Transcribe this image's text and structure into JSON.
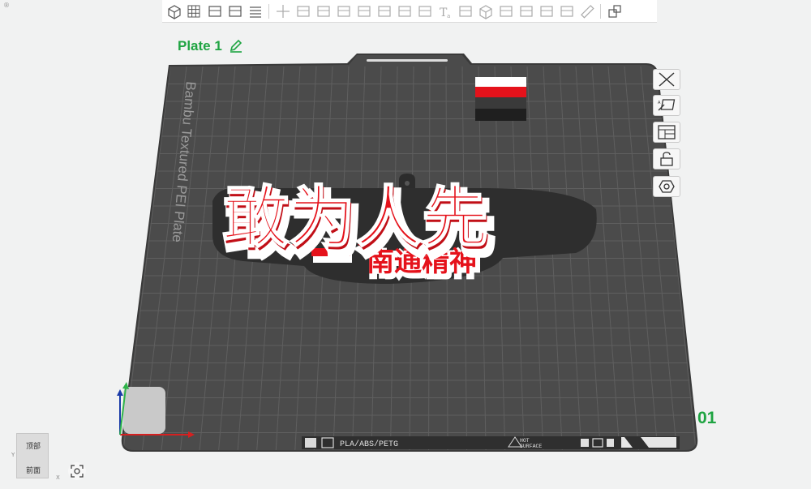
{
  "window": {
    "corner_mark": "®"
  },
  "toolbar": {
    "groups": [
      [
        "add-part-icon",
        "arrange-grid-icon",
        "auto-orient-icon",
        "plate-layout-icon",
        "list-icon"
      ],
      [
        "move-icon",
        "rotate-icon",
        "scale-icon",
        "lay-on-face-icon",
        "cut-icon",
        "mesh-boolean-icon",
        "support-paint-icon",
        "seam-paint-icon",
        "text-tool-icon",
        "svg-emboss-icon",
        "cube-icon",
        "fit-icon",
        "layers-icon",
        "variable-layer-icon",
        "placeholder-icon",
        "measure-icon"
      ],
      [
        "assembly-icon"
      ]
    ]
  },
  "plate": {
    "title": "Plate 1",
    "number": "01",
    "vertical_label": "Bambu Textured PEI Plate",
    "material_label": "PLA/ABS/PETG",
    "hot_surface_label": "HOT SURFACE",
    "hot_surface_line1": "HOT",
    "hot_surface_line2": "SURFACE"
  },
  "model": {
    "main_text": "敢为人先",
    "sub_text": "南通精神",
    "colors": {
      "face": "#e5121b",
      "highlight": "#ffffff",
      "base": "#2e2e2e"
    }
  },
  "filament_colors": [
    "#ffffff",
    "#e5121b",
    "#3a3a3a",
    "#1f1f1f"
  ],
  "side_buttons": [
    "delete-plate-icon",
    "auto-orient-plate-icon",
    "arrange-plate-icon",
    "lock-plate-icon",
    "plate-settings-icon"
  ],
  "view_cube": {
    "top_label": "顶部",
    "front_label": "前面",
    "y": "Y",
    "x": "X"
  },
  "colors": {
    "accent": "#1fa442",
    "bed": "#4b4b4b",
    "grid": "#5f5f5f"
  }
}
